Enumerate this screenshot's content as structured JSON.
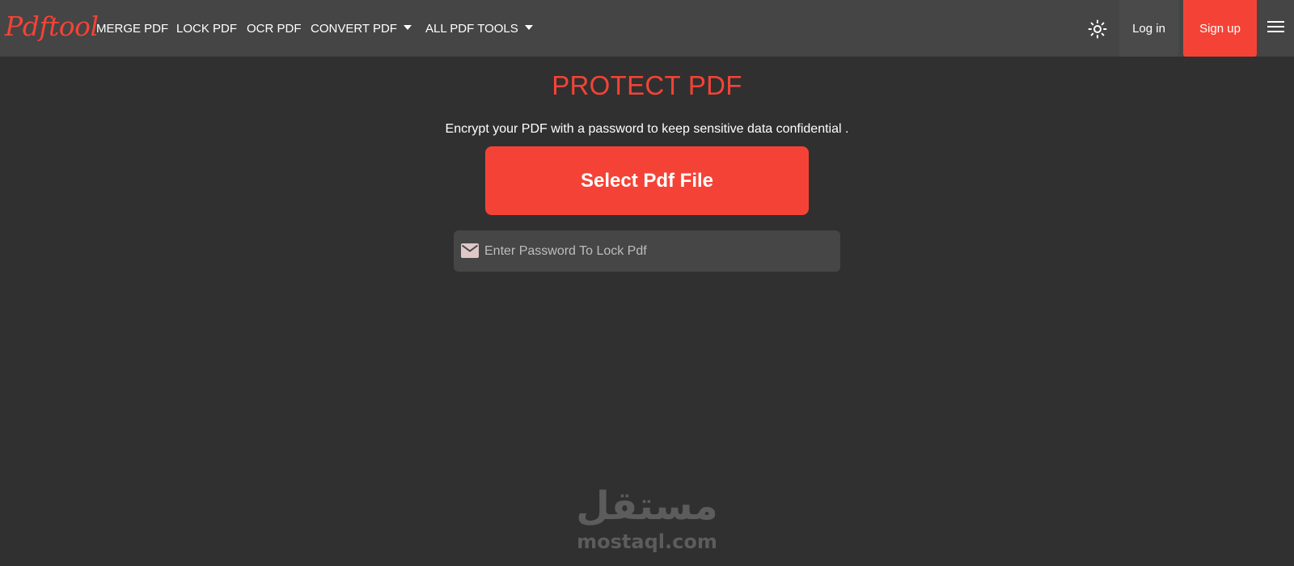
{
  "brand": {
    "logo_text": "Pdftool",
    "accent_color": "#f44336"
  },
  "nav": {
    "links": [
      {
        "label": "MERGE PDF"
      },
      {
        "label": "LOCK PDF"
      },
      {
        "label": "OCR PDF"
      },
      {
        "label": "CONVERT PDF",
        "has_dropdown": true
      },
      {
        "label": "ALL PDF TOOLS",
        "has_dropdown": true
      }
    ],
    "theme_toggle_icon": "sun-icon",
    "login_label": "Log in",
    "signup_label": "Sign up",
    "menu_icon": "hamburger-menu-icon"
  },
  "main": {
    "title": "PROTECT PDF",
    "subtitle": "Encrypt your PDF with a password to keep sensitive data confidential .",
    "select_button_label": "Select Pdf File",
    "password_field": {
      "icon": "envelope-icon",
      "placeholder": "Enter Password To Lock Pdf",
      "value": ""
    }
  },
  "watermark": {
    "arabic_text": "مستقل",
    "latin_text": "mostaql.com"
  },
  "colors": {
    "background": "#303030",
    "navbar": "#454545",
    "accent": "#f44336",
    "input_bg": "#464646"
  }
}
